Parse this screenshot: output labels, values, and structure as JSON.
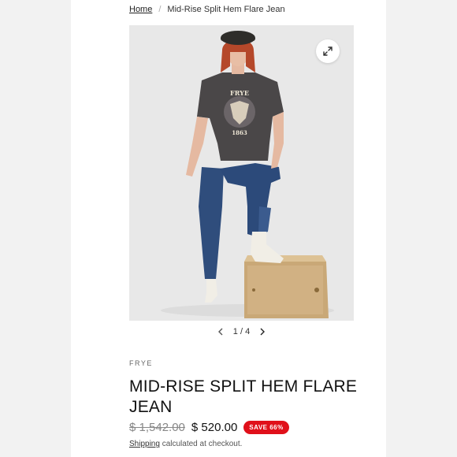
{
  "breadcrumb": {
    "home": "Home",
    "separator": "/",
    "current": "Mid-Rise Split Hem Flare Jean"
  },
  "gallery": {
    "tshirt_text_top": "FRYE",
    "tshirt_text_bottom": "1863",
    "zoom_icon": "expand-icon",
    "current": "1",
    "separator": "/",
    "total": "4"
  },
  "product": {
    "brand": "FRYE",
    "title": "MID-RISE SPLIT HEM FLARE JEAN",
    "original_price": "$ 1,542.00",
    "sale_price": "$ 520.00",
    "badge": "SAVE 66%",
    "shipping_link": "Shipping",
    "shipping_text": " calculated at checkout."
  },
  "colors": {
    "badge": "#e0101a",
    "background": "#f2f2f2",
    "page": "#ffffff"
  }
}
